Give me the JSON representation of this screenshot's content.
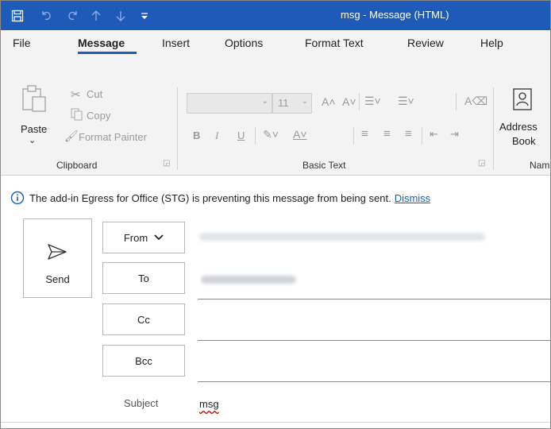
{
  "window": {
    "title": "msg  -  Message (HTML)"
  },
  "menu": {
    "tabs": [
      "File",
      "Message",
      "Insert",
      "Options",
      "Format Text",
      "Review",
      "Help"
    ],
    "active": "Message"
  },
  "ribbon": {
    "clipboard": {
      "paste": "Paste",
      "cut": "Cut",
      "copy": "Copy",
      "format_painter": "Format Painter",
      "label": "Clipboard"
    },
    "basic_text": {
      "font_size": "11",
      "label": "Basic Text",
      "bold": "B",
      "italic": "I",
      "underline": "U"
    },
    "names": {
      "address_book_line1": "Address",
      "address_book_line2": "Book",
      "label": "Nam"
    }
  },
  "infobar": {
    "message": "The add-in Egress for Office (STG) is preventing this message from being sent.",
    "dismiss": "Dismiss"
  },
  "compose": {
    "send": "Send",
    "from": "From",
    "to": "To",
    "cc": "Cc",
    "bcc": "Bcc",
    "subject_label": "Subject",
    "subject_value": "msg"
  },
  "colors": {
    "accent": "#1e5bb8",
    "link": "#1a5fb4"
  }
}
